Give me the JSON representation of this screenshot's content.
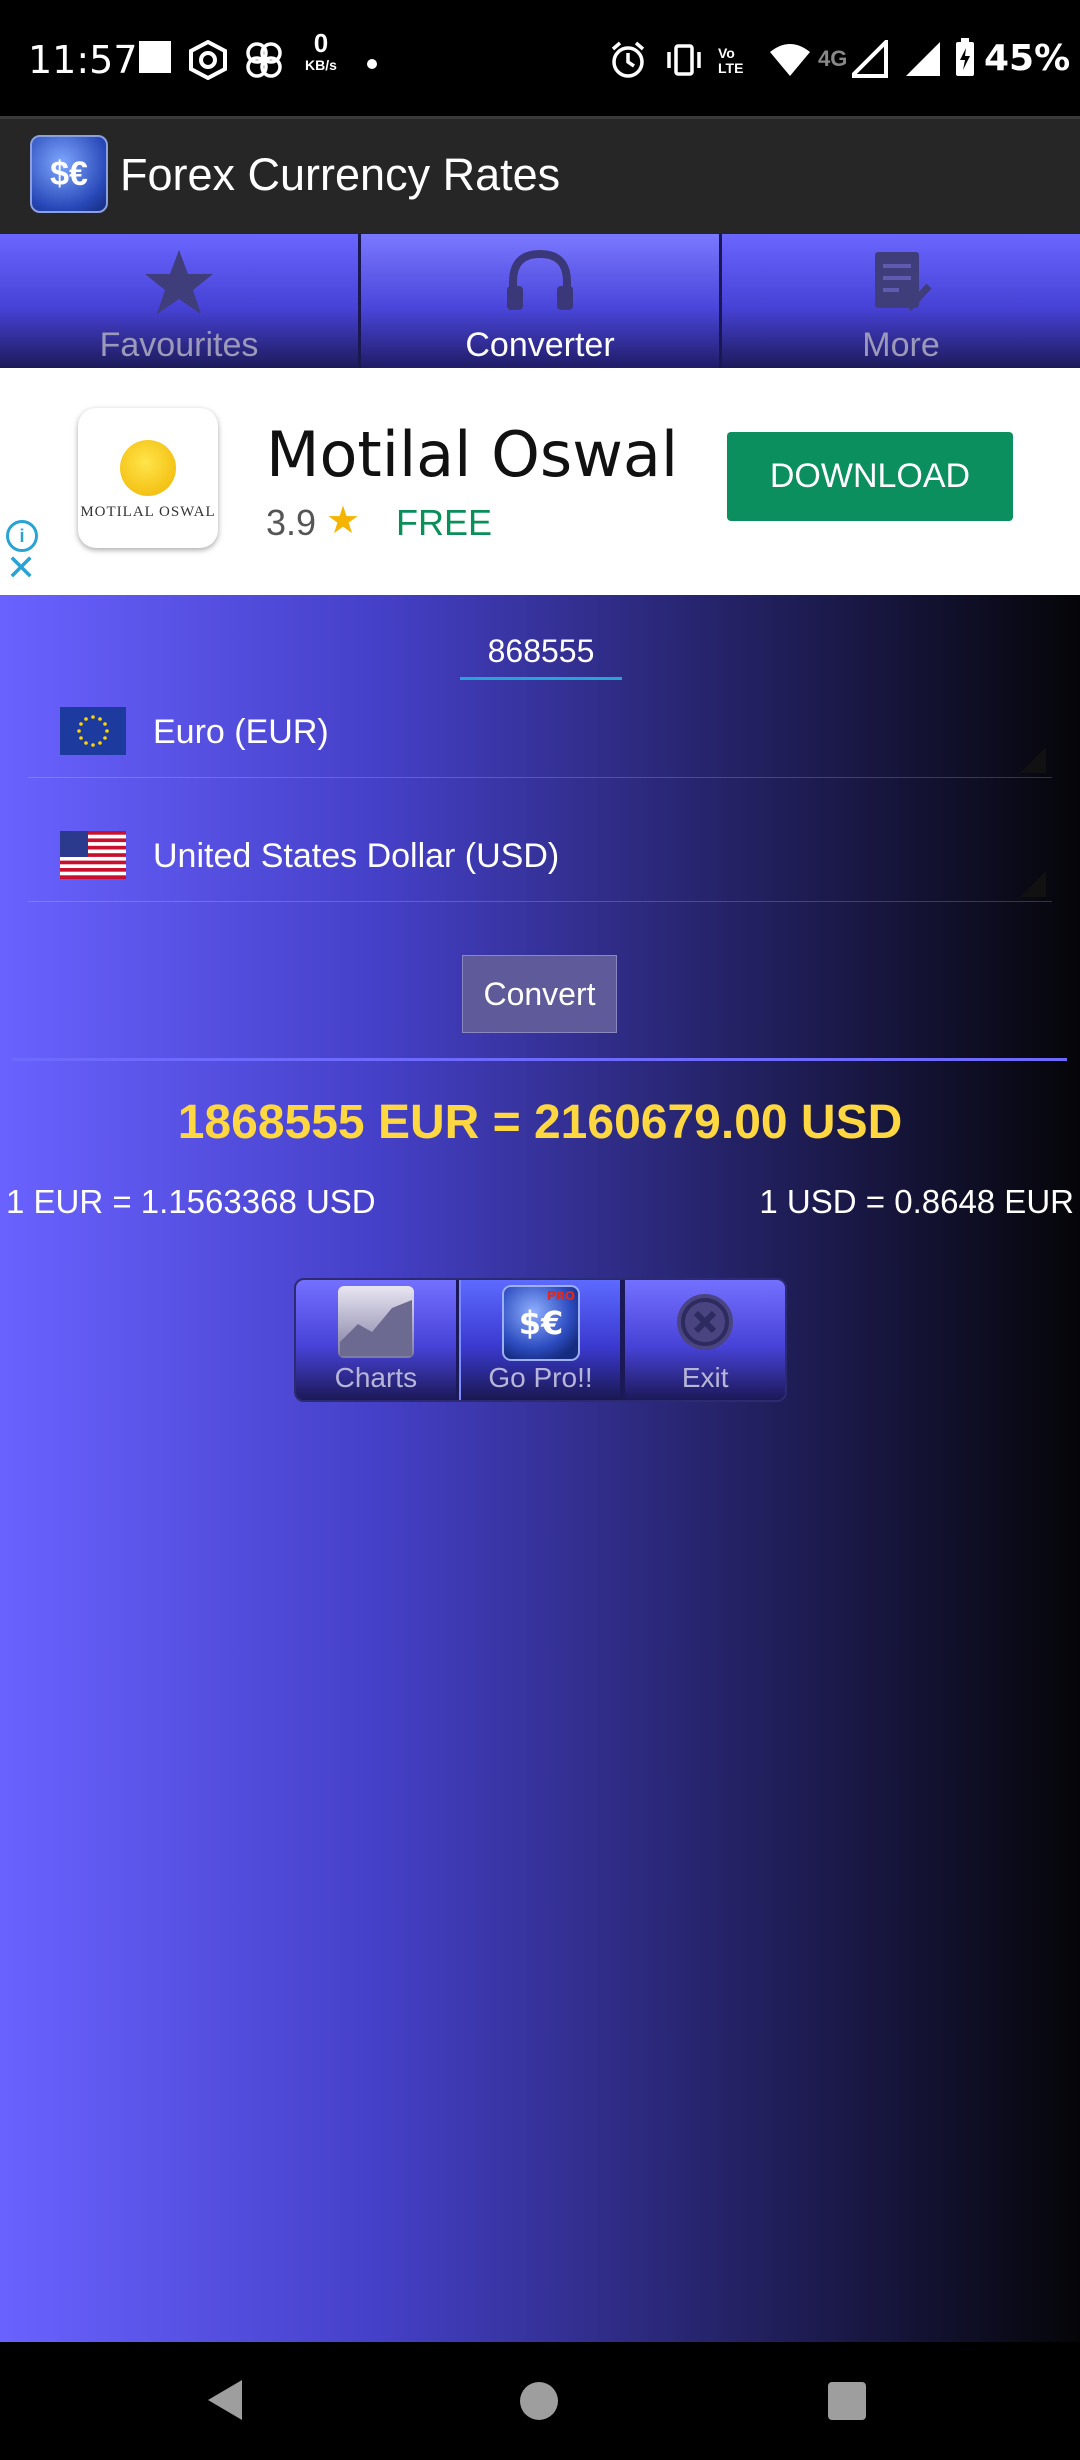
{
  "status_bar": {
    "time": "11:57",
    "network_speed_value": "0",
    "network_speed_unit": "KB/s",
    "network_type": "4G",
    "battery": "45%"
  },
  "app": {
    "title": "Forex Currency Rates",
    "icon_symbol": "$€"
  },
  "tabs": [
    {
      "label": "Favourites",
      "icon": "star-icon",
      "active": false
    },
    {
      "label": "Converter",
      "icon": "headphones-icon",
      "active": true
    },
    {
      "label": "More",
      "icon": "checklist-icon",
      "active": false
    }
  ],
  "ad": {
    "title": "Motilal Oswal",
    "logo_text": "MOTILAL OSWAL",
    "rating": "3.9",
    "price": "FREE",
    "button_label": "DOWNLOAD"
  },
  "converter": {
    "amount": "868555",
    "from_currency": "Euro (EUR)",
    "to_currency": "United States Dollar (USD)",
    "convert_label": "Convert",
    "result": "1868555 EUR = 2160679.00 USD",
    "rate_from": "1 EUR = 1.1563368 USD",
    "rate_to": "1 USD = 0.8648 EUR"
  },
  "actions": [
    {
      "label": "Charts",
      "icon": "chart-icon"
    },
    {
      "label": "Go Pro!!",
      "icon": "pro-app-icon"
    },
    {
      "label": "Exit",
      "icon": "exit-icon"
    }
  ],
  "colors": {
    "accent_yellow": "#ffd740",
    "ad_green": "#0b8f5e",
    "tab_blue": "#4a46db",
    "input_underline": "#29a3d6"
  }
}
